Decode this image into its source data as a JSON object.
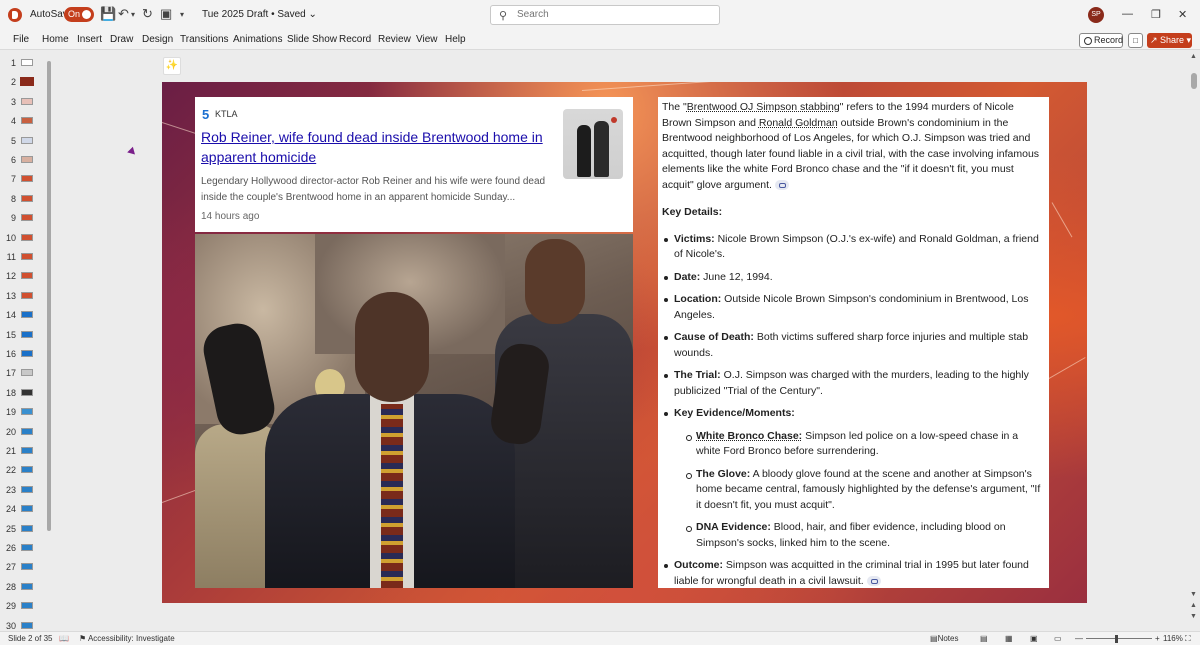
{
  "titlebar": {
    "autosave_label": "AutoSave",
    "autosave_state": "On",
    "doc_title": "Tue 2025 Draft • Saved",
    "search_placeholder": "Search",
    "avatar_initials": "SP",
    "brand_color": "#c43e1c"
  },
  "menu": {
    "items": [
      "File",
      "Home",
      "Insert",
      "Draw",
      "Design",
      "Transitions",
      "Animations",
      "Slide Show",
      "Record",
      "Review",
      "View",
      "Help"
    ],
    "record_label": "Record",
    "share_label": "Share"
  },
  "thumbnails": {
    "numbers": [
      "1",
      "2",
      "3",
      "4",
      "5",
      "6",
      "7",
      "8",
      "9",
      "10",
      "11",
      "12",
      "13",
      "14",
      "15",
      "16",
      "17",
      "18",
      "19",
      "20",
      "21",
      "22",
      "23",
      "24",
      "25",
      "26",
      "27",
      "28",
      "29",
      "30"
    ],
    "active": "2"
  },
  "slide": {
    "news": {
      "source_logo": "5",
      "source_name": "KTLA",
      "headline": "Rob Reiner, wife found dead inside Brentwood home in apparent homicide",
      "snippet": "Legendary Hollywood director-actor Rob Reiner and his wife were found dead inside the couple's Brentwood home in an apparent homicide Sunday...",
      "time": "14 hours ago"
    },
    "panel": {
      "intro_1": "The \"",
      "intro_link1": "Brentwood OJ Simpson stabbing",
      "intro_2": "\" refers to the 1994 murders of Nicole Brown Simpson and ",
      "intro_link2": "Ronald Goldman",
      "intro_3": " outside Brown's condominium in the Brentwood neighborhood of Los Angeles, for which O.J. Simpson was tried and acquitted, though later found liable in a civil trial, with the case involving infamous elements like the white Ford Bronco chase and the \"if it doesn't fit, you must acquit\" glove argument.",
      "key_details_heading": "Key Details:",
      "details": [
        {
          "label": "Victims:",
          "text": " Nicole Brown Simpson (O.J.'s ex-wife) and Ronald Goldman, a friend of Nicole's."
        },
        {
          "label": "Date:",
          "text": " June 12, 1994."
        },
        {
          "label": "Location:",
          "text": " Outside Nicole Brown Simpson's condominium in Brentwood, Los Angeles."
        },
        {
          "label": "Cause of Death:",
          "text": " Both victims suffered sharp force injuries and multiple stab wounds."
        },
        {
          "label": "The Trial:",
          "text": " O.J. Simpson was charged with the murders, leading to the highly publicized \"Trial of the Century\"."
        }
      ],
      "evidence_heading": "Key Evidence/Moments:",
      "evidence": [
        {
          "label": "White Bronco Chase:",
          "text": " Simpson led police on a low-speed chase in a white Ford Bronco before surrendering."
        },
        {
          "label": "The Glove:",
          "text": " A bloody glove found at the scene and another at Simpson's home became central, famously highlighted by the defense's argument, \"If it doesn't fit, you must acquit\"."
        },
        {
          "label": "DNA Evidence:",
          "text": " Blood, hair, and fiber evidence, including blood on Simpson's socks, linked him to the scene."
        }
      ],
      "outcome_label": "Outcome:",
      "outcome_text": " Simpson was acquitted in the criminal trial in 1995 but later found liable for wrongful death in a civil lawsuit."
    }
  },
  "statusbar": {
    "slide_of": "Slide 2 of 35",
    "accessibility": "Accessibility: Investigate",
    "notes": "Notes",
    "zoom": "116%"
  }
}
